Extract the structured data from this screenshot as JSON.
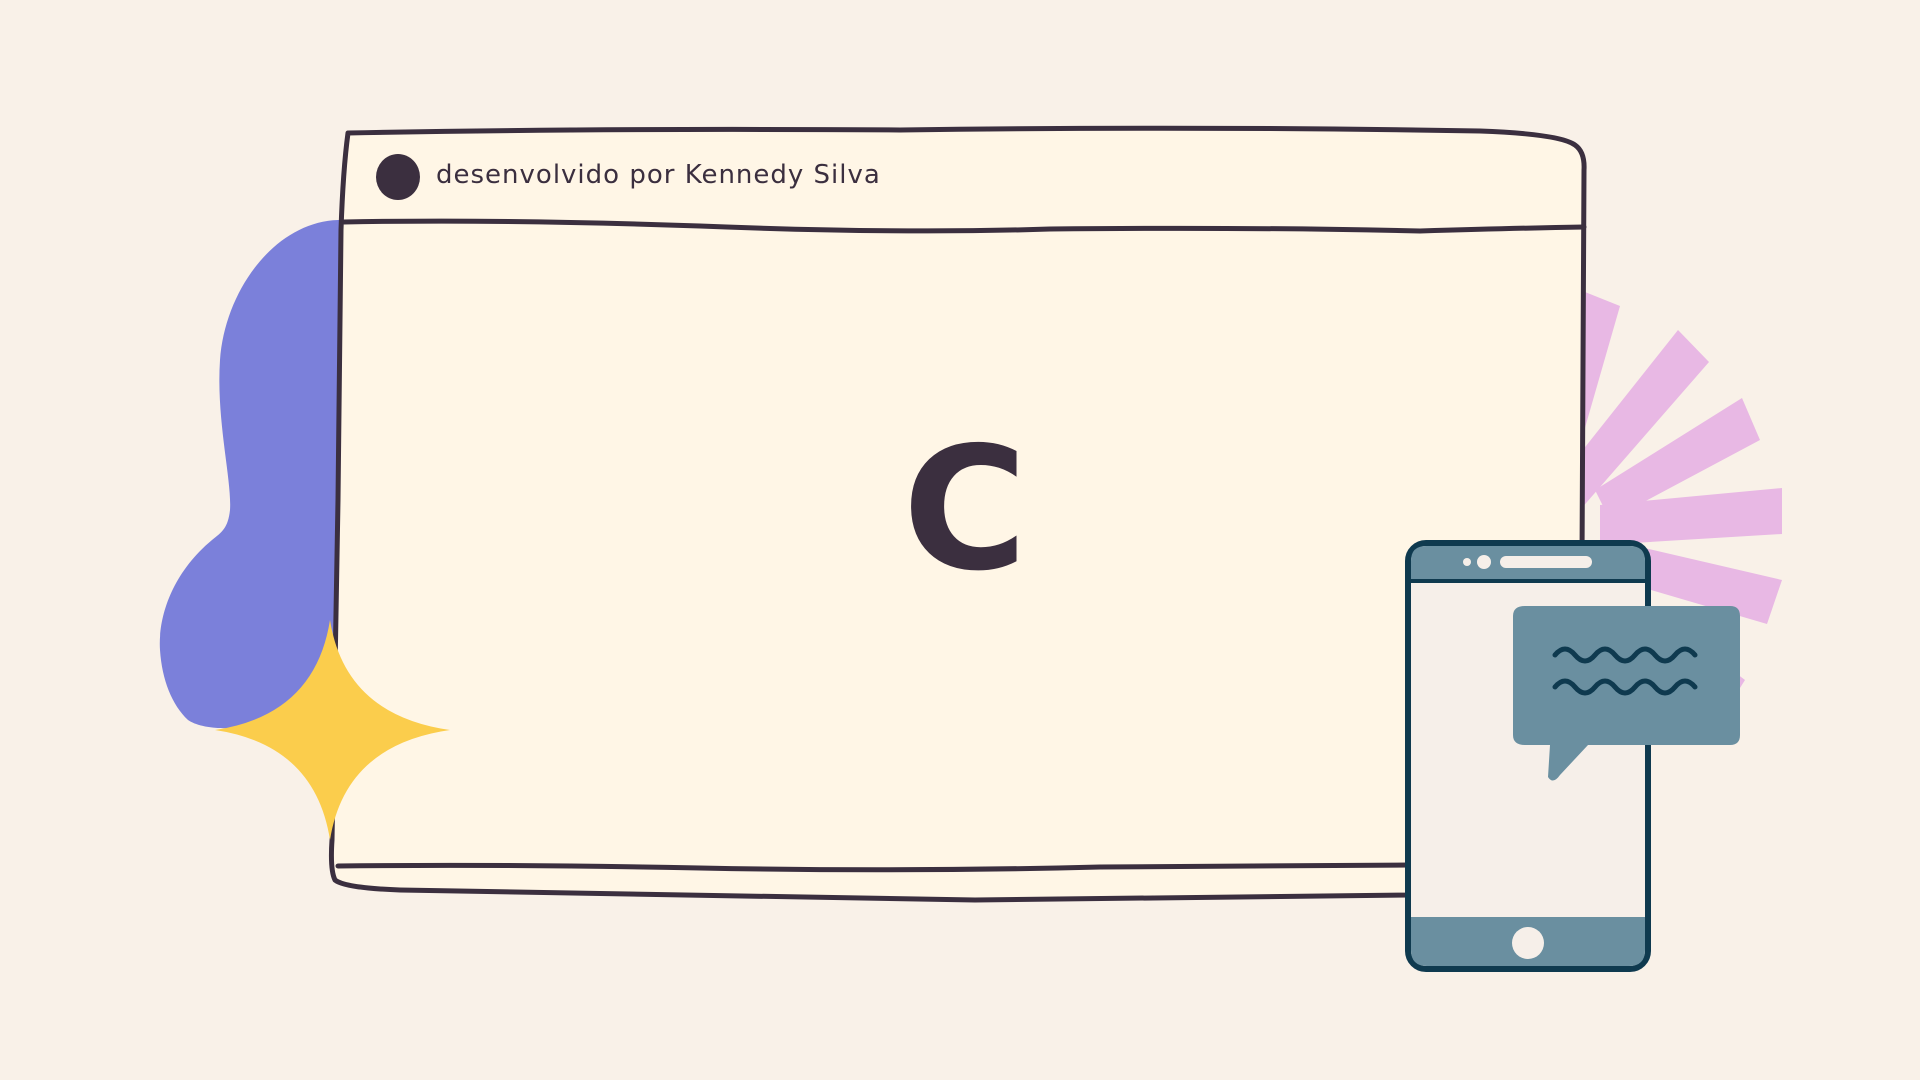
{
  "window": {
    "title": "desenvolvido por Kennedy Silva",
    "center_letter": "C"
  },
  "decorations": {
    "blob": "purple-blob",
    "sparkle": "yellow-sparkle-icon",
    "burst": "pink-burst",
    "phone": "smartphone-icon",
    "chat": "chat-bubble-icon"
  },
  "colors": {
    "background": "#f9f1e8",
    "window_fill": "#fff6e6",
    "outline": "#3b2f3f",
    "blob": "#7b80da",
    "sparkle": "#fbcd4c",
    "burst": "#e8b8e4",
    "phone_outline": "#0f3a4f",
    "phone_accent": "#6a8fa0"
  }
}
